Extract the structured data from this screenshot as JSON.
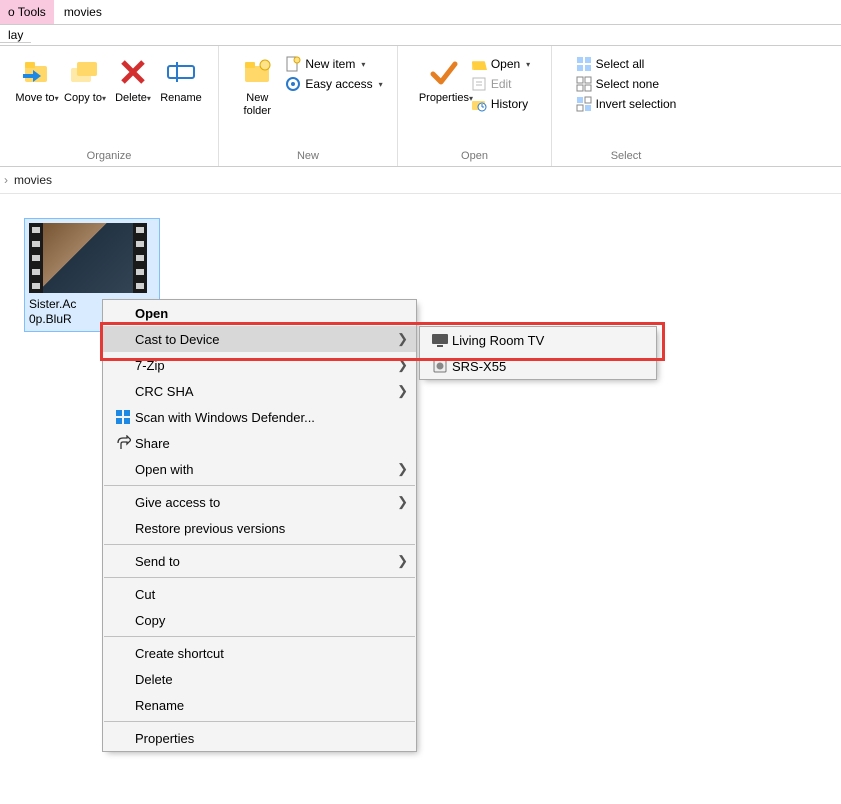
{
  "title": {
    "tools_tab": "o Tools",
    "window_title": "movies",
    "play_tab": "lay"
  },
  "ribbon": {
    "organize": {
      "move_to": "Move to",
      "copy_to": "Copy to",
      "delete": "Delete",
      "rename": "Rename",
      "group_label": "Organize"
    },
    "new": {
      "new_folder": "New folder",
      "new_item": "New item",
      "easy_access": "Easy access",
      "group_label": "New"
    },
    "open": {
      "properties": "Properties",
      "open": "Open",
      "edit": "Edit",
      "history": "History",
      "group_label": "Open"
    },
    "select": {
      "select_all": "Select all",
      "select_none": "Select none",
      "invert": "Invert selection",
      "group_label": "Select"
    }
  },
  "breadcrumb": {
    "current": "movies"
  },
  "file": {
    "name_line1": "Sister.Ac",
    "name_line2": "0p.BluR"
  },
  "context_menu": {
    "open": "Open",
    "cast": "Cast to Device",
    "zip": "7-Zip",
    "crc": "CRC SHA",
    "defender": "Scan with Windows Defender...",
    "share": "Share",
    "open_with": "Open with",
    "give_access": "Give access to",
    "restore": "Restore previous versions",
    "send_to": "Send to",
    "cut": "Cut",
    "copy": "Copy",
    "shortcut": "Create shortcut",
    "delete": "Delete",
    "rename": "Rename",
    "properties": "Properties"
  },
  "submenu": {
    "device1": "Living Room TV",
    "device2": "SRS-X55"
  }
}
